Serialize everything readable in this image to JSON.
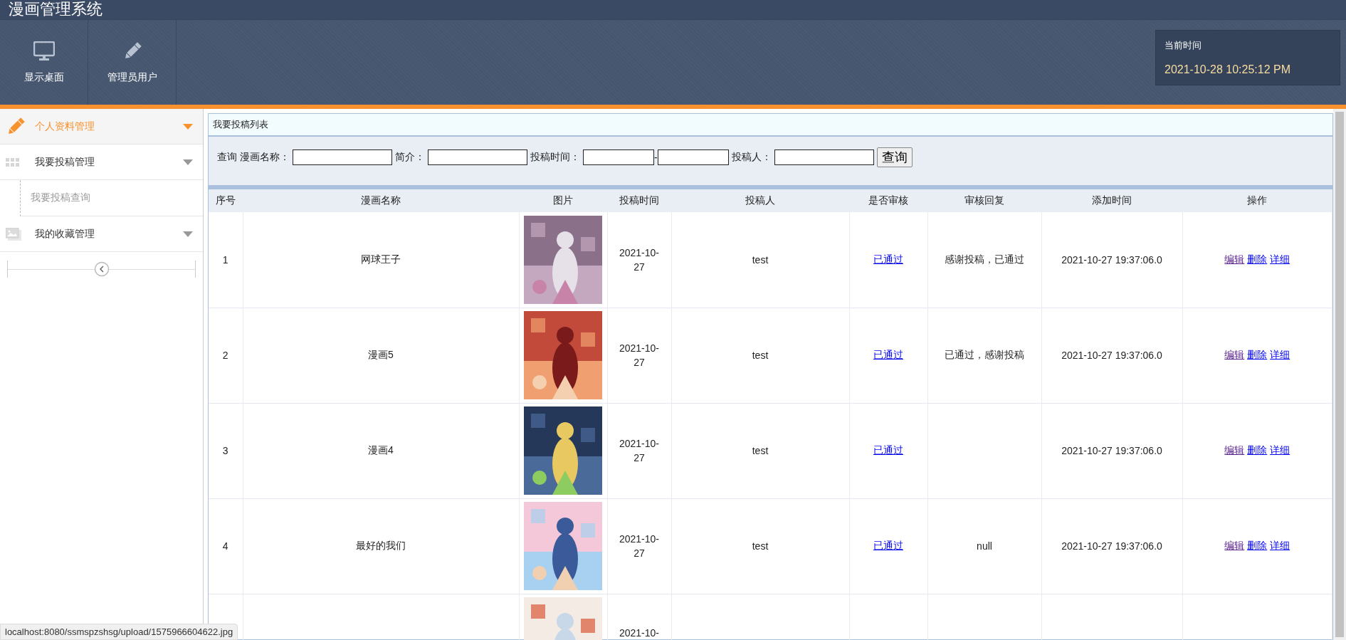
{
  "app_title": "漫画管理系统",
  "toolbar": [
    {
      "label": "显示桌面"
    },
    {
      "label": "管理员用户"
    }
  ],
  "clock": {
    "label": "当前时间",
    "value": "2021-10-28 10:25:12 PM"
  },
  "sidebar": {
    "items": [
      {
        "label": "个人资料管理",
        "selected": true
      },
      {
        "label": "我要投稿管理",
        "selected": false,
        "children": [
          {
            "label": "我要投稿查询"
          }
        ]
      },
      {
        "label": "我的收藏管理",
        "selected": false
      }
    ]
  },
  "panel": {
    "title": "我要投稿列表",
    "search": {
      "prefix": "查询",
      "fields": [
        {
          "label": "漫画名称：",
          "kind": "text"
        },
        {
          "label": "简介：",
          "kind": "text"
        },
        {
          "label": "投稿时间：",
          "kind": "range",
          "separator": "-"
        },
        {
          "label": "投稿人：",
          "kind": "text"
        }
      ],
      "button": "查询"
    },
    "table": {
      "columns": [
        "序号",
        "漫画名称",
        "图片",
        "投稿时间",
        "投稿人",
        "是否审核",
        "审核回复",
        "添加时间",
        "操作"
      ],
      "rows": [
        {
          "index": "1",
          "name": "网球王子",
          "picture": {
            "kind": "picture"
          },
          "date": "2021-10-27",
          "author": "test",
          "audit": "已通过",
          "reply": "感谢投稿，已通过",
          "added": "2021-10-27 19:37:06.0",
          "actions": [
            {
              "label": "编辑",
              "visited": true
            },
            {
              "label": "删除",
              "visited": false
            },
            {
              "label": "详细",
              "visited": false
            }
          ]
        },
        {
          "index": "2",
          "name": "漫画5",
          "picture": {
            "kind": "picture"
          },
          "date": "2021-10-27",
          "author": "test",
          "audit": "已通过",
          "reply": "已通过，感谢投稿",
          "added": "2021-10-27 19:37:06.0",
          "actions": [
            {
              "label": "编辑",
              "visited": true
            },
            {
              "label": "删除",
              "visited": false
            },
            {
              "label": "详细",
              "visited": false
            }
          ]
        },
        {
          "index": "3",
          "name": "漫画4",
          "picture": {
            "kind": "picture"
          },
          "date": "2021-10-27",
          "author": "test",
          "audit": "已通过",
          "added": "2021-10-27 19:37:06.0",
          "actions": [
            {
              "label": "编辑",
              "visited": true
            },
            {
              "label": "删除",
              "visited": false
            },
            {
              "label": "详细",
              "visited": false
            }
          ]
        },
        {
          "index": "4",
          "name": "最好的我们",
          "picture": {
            "kind": "picture"
          },
          "date": "2021-10-27",
          "author": "test",
          "audit": "已通过",
          "reply": "null",
          "added": "2021-10-27 19:37:06.0",
          "actions": [
            {
              "label": "编辑",
              "visited": true
            },
            {
              "label": "删除",
              "visited": false
            },
            {
              "label": "详细",
              "visited": false
            }
          ]
        },
        {
          "picture": {
            "kind": "picture"
          },
          "date": "2021-10-"
        }
      ]
    }
  },
  "status_bar": "localhost:8080/ssmspzshsg/upload/1575966604622.jpg"
}
